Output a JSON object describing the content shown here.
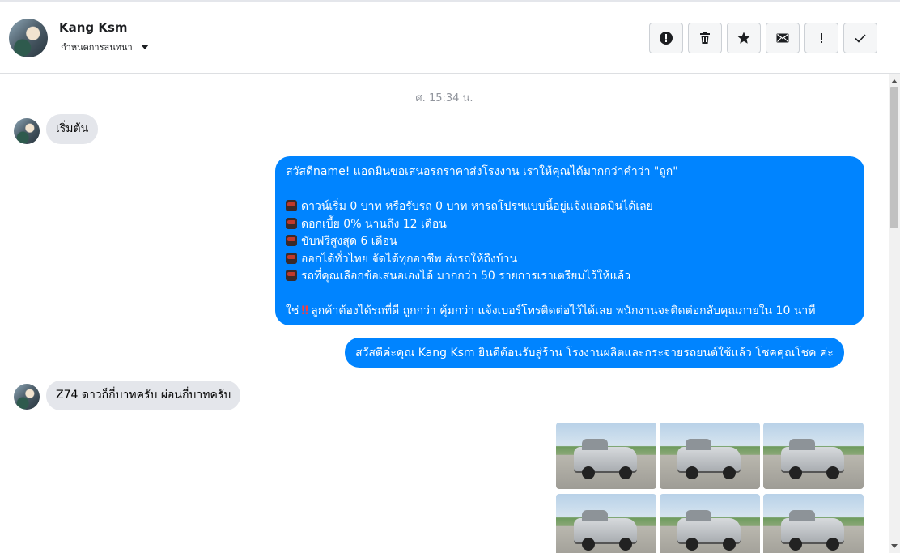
{
  "header": {
    "contact_name": "Kang Ksm",
    "subtitle": "กำหนดการสนทนา",
    "actions": [
      {
        "name": "report-icon"
      },
      {
        "name": "trash-icon"
      },
      {
        "name": "star-icon"
      },
      {
        "name": "mail-icon"
      },
      {
        "name": "exclamation-icon"
      },
      {
        "name": "check-icon"
      }
    ]
  },
  "chat": {
    "timestamp": "ศ. 15:34 น.",
    "messages": [
      {
        "from": "customer",
        "text": "เริ่มต้น"
      },
      {
        "from": "page",
        "lines": [
          "สวัสดีname! แอดมินขอเสนอรถราคาส่งโรงงาน เราให้คุณได้มากกว่าคำว่า \"ถูก\"",
          "",
          "ดาวน์เริ่ม 0 บาท หรือรับรถ 0 บาท หารถโปรฯแบบนี้อยู่แจ้งแอดมินได้เลย",
          "ดอกเบี้ย 0% นานถึง 12 เดือน",
          "ขับฟรีสูงสุด 6 เดือน",
          "ออกได้ทั่วไทย จัดได้ทุกอาชีพ ส่งรถให้ถึงบ้าน",
          "รถที่คุณเลือกข้อเสนอเองได้ มากกว่า 50 รายการเราเตรียมไว้ให้แล้ว",
          "",
          "ใช่",
          "ลูกค้าต้องได้รถที่ดี ถูกกว่า คุ้มกว่า แจ้งเบอร์โทรติดต่อไว้ได้เลย พนักงานจะติดต่อกลับคุณภายใน 10 นาที"
        ]
      },
      {
        "from": "page",
        "text": "สวัสดีค่ะคุณ Kang Ksm ยินดีต้อนรับสู่ร้าน โรงงานผลิตและกระจายรถยนต์ใช้แล้ว โชคคุณโชค ค่ะ"
      },
      {
        "from": "customer",
        "text": "Z74 ดาวก็กี่บาทครับ ผ่อนกี่บาทครับ"
      }
    ],
    "photos_count": 6
  },
  "colors": {
    "outgoing_bubble": "#0084ff",
    "incoming_bubble": "#e4e6eb"
  }
}
